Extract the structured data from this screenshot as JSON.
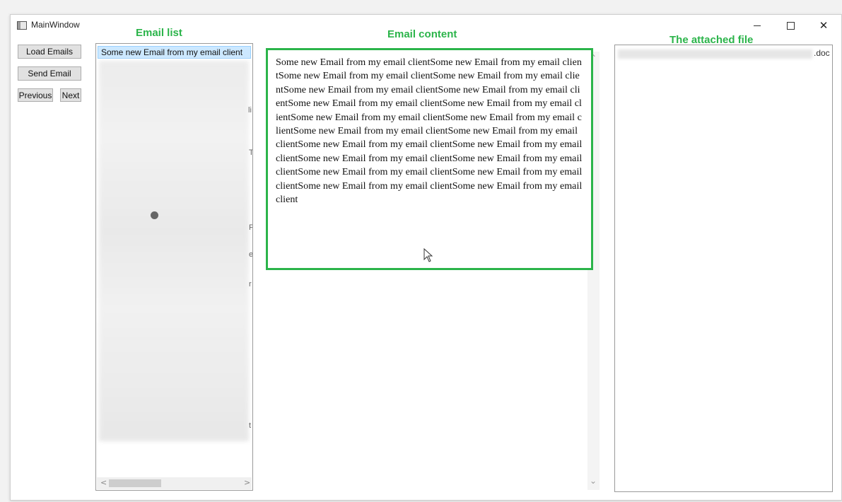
{
  "window": {
    "title": "MainWindow",
    "controls": {
      "minimize_icon": "minimize-icon",
      "maximize_icon": "maximize-icon",
      "close_icon": "close-icon",
      "close_glyph": "✕"
    }
  },
  "annotations": {
    "email_list": "Email list",
    "email_content": "Email content",
    "attached_file": "The attached file",
    "color": "#2bb44a"
  },
  "buttons": {
    "load_emails": "Load Emails",
    "send_email": "Send Email",
    "previous": "Previous",
    "next": "Next"
  },
  "email_list": {
    "selected_item": "Some new Email from my email client",
    "fragments": [
      "li",
      "T",
      "P",
      "e",
      "r",
      "t"
    ]
  },
  "email_content": {
    "body": "Some new Email from my email clientSome new Email from my email clientSome new Email from my email clientSome new Email from my email clientSome new Email from my email clientSome new Email from my email clientSome new Email from my email clientSome new Email from my email clientSome new Email from my email clientSome new Email from my email clientSome new Email from my email clientSome new Email from my email clientSome new Email from my email clientSome new Email from my email clientSome new Email from my email clientSome new Email from my email clientSome new Email from my email clientSome new Email from my email clientSome new Email from my email clientSome new Email from my email client"
  },
  "attachment": {
    "file_extension": ".doc"
  },
  "colors": {
    "selection_bg": "#cce8ff",
    "annotation_green": "#2bb44a"
  }
}
